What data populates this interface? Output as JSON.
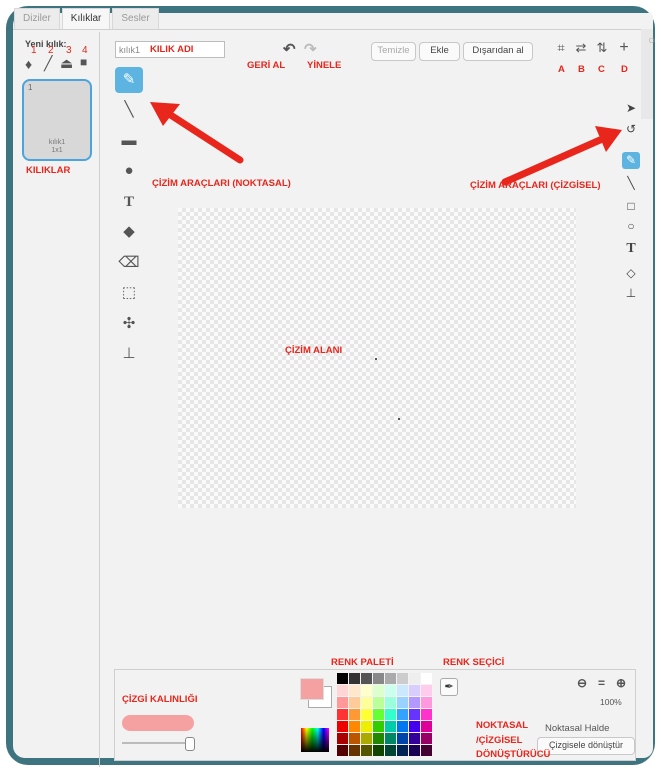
{
  "tabs": [
    {
      "label": "Diziler"
    },
    {
      "label": "Kılıklar"
    },
    {
      "label": "Sesler"
    }
  ],
  "new_costume": {
    "label": "Yeni kılık:",
    "numbers": [
      "1",
      "2",
      "3",
      "4"
    ]
  },
  "costume": {
    "number": "1",
    "name": "kılık1",
    "size": "1x1"
  },
  "name_input": {
    "value": "kılık1"
  },
  "toolbar": {
    "clear": "Temizle",
    "add": "Ekle",
    "import": "Dışarıdan al",
    "top_letters": [
      "A",
      "B",
      "C",
      "D"
    ]
  },
  "annotations": {
    "costume_name": "KILIK ADI",
    "undo": "GERİ AL",
    "redo": "YİNELE",
    "costumes": "KILIKLAR",
    "bitmap_tools": "ÇİZİM ARAÇLARI  (NOKTASAL)",
    "vector_tools": "ÇİZİM ARAÇLARI (ÇİZGİSEL)",
    "drawing_area": "ÇİZİM ALANI",
    "color_palette": "RENK PALETİ",
    "color_picker": "RENK SEÇİCİ",
    "line_width": "ÇİZGİ KALINLIĞI",
    "converter_1": "NOKTASAL",
    "converter_2": "/ÇİZGİSEL",
    "converter_3": "DÖNÜŞTÜRÜCÜ"
  },
  "bottom": {
    "zoom": "100%",
    "mode": "Noktasal Halde",
    "convert_button": "Çizgisele dönüştür",
    "palette_colors": [
      "#000000",
      "#333333",
      "#555555",
      "#888888",
      "#aaaaaa",
      "#cccccc",
      "#eeeeee",
      "#ffffff",
      "#ffd6d6",
      "#ffe7cc",
      "#ffffcc",
      "#ddffcc",
      "#ccffee",
      "#cce8ff",
      "#d9ccff",
      "#ffccee",
      "#ff9999",
      "#ffcc99",
      "#ffff99",
      "#bbff99",
      "#99ffdd",
      "#99d1ff",
      "#b399ff",
      "#ff99dd",
      "#ff3333",
      "#ff9933",
      "#ffff33",
      "#66ff33",
      "#33ffcc",
      "#33a3ff",
      "#6633ff",
      "#ff33cc",
      "#ee0000",
      "#ff8800",
      "#eeee00",
      "#33cc00",
      "#00ccaa",
      "#0077ee",
      "#4400ee",
      "#dd0099",
      "#aa0000",
      "#bb5500",
      "#aaaa00",
      "#228800",
      "#008866",
      "#0044aa",
      "#330099",
      "#990066",
      "#550000",
      "#663300",
      "#555500",
      "#114400",
      "#004433",
      "#002255",
      "#1a0055",
      "#440033"
    ],
    "pen_color": "#f6a1a1"
  },
  "colors": {
    "frame": "#3d7480",
    "annotation_red": "#e8261c",
    "tool_selected": "#5db4e0"
  }
}
